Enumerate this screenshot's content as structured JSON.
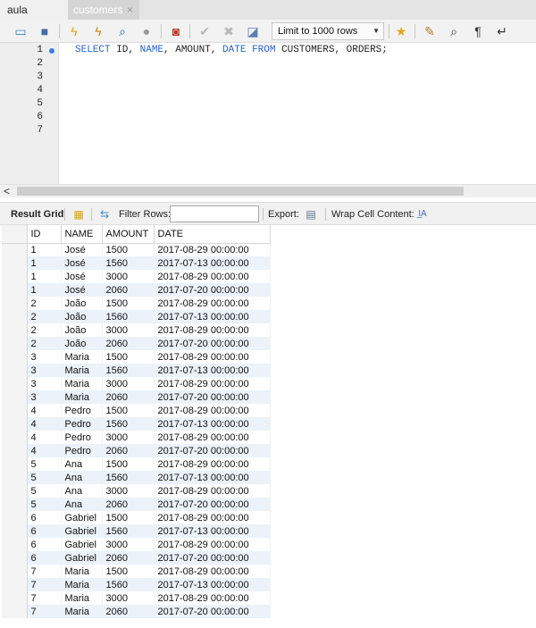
{
  "tabs": [
    {
      "label": "aula"
    },
    {
      "label": "customers",
      "close": "×"
    }
  ],
  "toolbar": {
    "limit_label": "Limit to 1000 rows"
  },
  "editor": {
    "line_numbers": [
      "1",
      "2",
      "3",
      "4",
      "5",
      "6",
      "7"
    ],
    "line1": {
      "t1": "SELECT",
      "t2": " ID, ",
      "t3": "NAME",
      "t4": ", AMOUNT, ",
      "t5": "DATE",
      "t6": " ",
      "t7": "FROM",
      "t8": " CUSTOMERS, ORDERS;"
    }
  },
  "scroll": {
    "left_arrow": "<"
  },
  "result_bar": {
    "result_grid_label": "Result Grid",
    "filter_label": "Filter Rows:",
    "filter_value": "",
    "export_label": "Export:",
    "wrap_label": "Wrap Cell Content:"
  },
  "grid": {
    "columns": [
      "ID",
      "NAME",
      "AMOUNT",
      "DATE"
    ],
    "rows": [
      [
        "1",
        "José",
        "1500",
        "2017-08-29 00:00:00"
      ],
      [
        "1",
        "José",
        "1560",
        "2017-07-13 00:00:00"
      ],
      [
        "1",
        "José",
        "3000",
        "2017-08-29 00:00:00"
      ],
      [
        "1",
        "José",
        "2060",
        "2017-07-20 00:00:00"
      ],
      [
        "2",
        "João",
        "1500",
        "2017-08-29 00:00:00"
      ],
      [
        "2",
        "João",
        "1560",
        "2017-07-13 00:00:00"
      ],
      [
        "2",
        "João",
        "3000",
        "2017-08-29 00:00:00"
      ],
      [
        "2",
        "João",
        "2060",
        "2017-07-20 00:00:00"
      ],
      [
        "3",
        "Maria",
        "1500",
        "2017-08-29 00:00:00"
      ],
      [
        "3",
        "Maria",
        "1560",
        "2017-07-13 00:00:00"
      ],
      [
        "3",
        "Maria",
        "3000",
        "2017-08-29 00:00:00"
      ],
      [
        "3",
        "Maria",
        "2060",
        "2017-07-20 00:00:00"
      ],
      [
        "4",
        "Pedro",
        "1500",
        "2017-08-29 00:00:00"
      ],
      [
        "4",
        "Pedro",
        "1560",
        "2017-07-13 00:00:00"
      ],
      [
        "4",
        "Pedro",
        "3000",
        "2017-08-29 00:00:00"
      ],
      [
        "4",
        "Pedro",
        "2060",
        "2017-07-20 00:00:00"
      ],
      [
        "5",
        "Ana",
        "1500",
        "2017-08-29 00:00:00"
      ],
      [
        "5",
        "Ana",
        "1560",
        "2017-07-13 00:00:00"
      ],
      [
        "5",
        "Ana",
        "3000",
        "2017-08-29 00:00:00"
      ],
      [
        "5",
        "Ana",
        "2060",
        "2017-07-20 00:00:00"
      ],
      [
        "6",
        "Gabriel",
        "1500",
        "2017-08-29 00:00:00"
      ],
      [
        "6",
        "Gabriel",
        "1560",
        "2017-07-13 00:00:00"
      ],
      [
        "6",
        "Gabriel",
        "3000",
        "2017-08-29 00:00:00"
      ],
      [
        "6",
        "Gabriel",
        "2060",
        "2017-07-20 00:00:00"
      ],
      [
        "7",
        "Maria",
        "1500",
        "2017-08-29 00:00:00"
      ],
      [
        "7",
        "Maria",
        "1560",
        "2017-07-13 00:00:00"
      ],
      [
        "7",
        "Maria",
        "3000",
        "2017-08-29 00:00:00"
      ],
      [
        "7",
        "Maria",
        "2060",
        "2017-07-20 00:00:00"
      ]
    ]
  }
}
